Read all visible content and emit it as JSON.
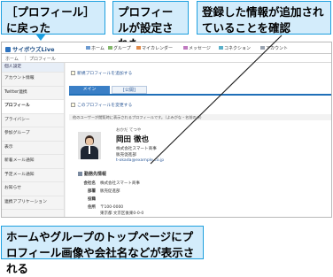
{
  "callouts": {
    "back": "［プロフィール］に戻った",
    "set": "プロフィールが設定された",
    "confirm": "登録した情報が追加されていることを確認",
    "bottom": "ホームやグループのトップページにプロフィール画像や会社名などが表示される"
  },
  "app": {
    "logo": "サイボウズLive",
    "topnav": [
      "ホーム",
      "グループ",
      "マイカレンダー",
      "メッセージ",
      "コネクション",
      "アカウント"
    ]
  },
  "breadcrumb": [
    "ホーム",
    "プロフィール"
  ],
  "sidebar": {
    "header": "個人設定",
    "items": [
      "アカウント情報",
      "Twitter連携",
      "プロフィール",
      "プライバシー",
      "参加グループ",
      "表示",
      "新着メール通知",
      "予定メール通知",
      "お知らせ",
      "連携アプリケーション"
    ]
  },
  "main": {
    "add_profile_link": "新規プロフィールを追加する",
    "tabs": [
      "メイン",
      "[公開]"
    ],
    "edit_profile_link": "このプロフィールを変更する",
    "notice": "他のユーザーが閲覧時に表示されるプロフィールです。（よみがな・名前のみ）"
  },
  "profile": {
    "kana": "おかだ てつや",
    "name": "岡田 徹也",
    "company": "株式会社スマート商事",
    "department": "販売促進部",
    "email": "t-okada@example.co.jp"
  },
  "work_section": {
    "title": "勤務先情報",
    "rows": [
      {
        "label": "会社名",
        "value": "株式会社スマート商事"
      },
      {
        "label": "部署",
        "value": "販売促進部"
      },
      {
        "label": "役職",
        "value": ""
      },
      {
        "label": "住所",
        "value": "〒100-0000"
      },
      {
        "label": "",
        "value": "東京都 文京区後楽0-0-0"
      }
    ]
  }
}
